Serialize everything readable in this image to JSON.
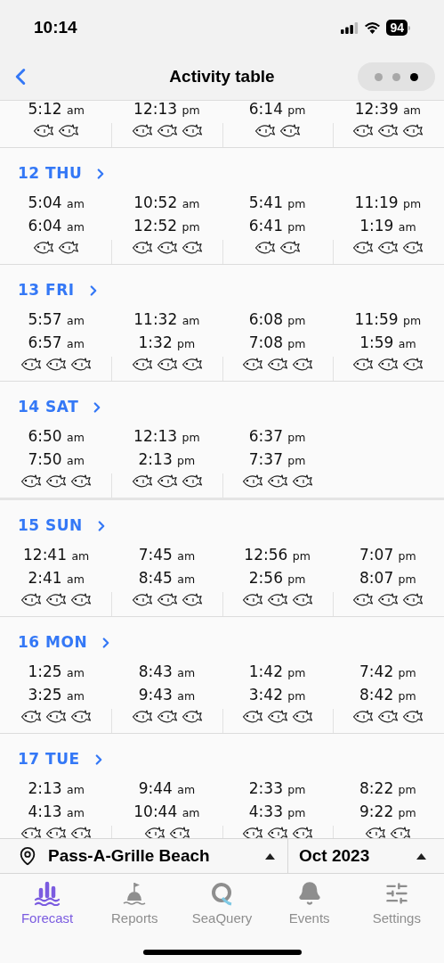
{
  "status_bar": {
    "time": "10:14",
    "battery": "94"
  },
  "nav": {
    "title": "Activity table",
    "pages": [
      {
        "selected": false
      },
      {
        "selected": false
      },
      {
        "selected": true
      }
    ]
  },
  "top_row": {
    "cells": [
      {
        "lines": [
          {
            "time": "5:12",
            "period": "am"
          }
        ],
        "icons": [
          {
            "kind": "fish"
          },
          {
            "kind": "fish"
          }
        ]
      },
      {
        "lines": [
          {
            "time": "12:13",
            "period": "pm"
          }
        ],
        "icons": [
          {
            "kind": "fish"
          },
          {
            "kind": "fish"
          },
          {
            "kind": "fish"
          }
        ]
      },
      {
        "lines": [
          {
            "time": "6:14",
            "period": "pm"
          }
        ],
        "icons": [
          {
            "kind": "fish"
          },
          {
            "kind": "fish"
          }
        ]
      },
      {
        "lines": [
          {
            "time": "12:39",
            "period": "am"
          }
        ],
        "icons": [
          {
            "kind": "fish"
          },
          {
            "kind": "fish"
          },
          {
            "kind": "fish"
          }
        ]
      }
    ]
  },
  "days": [
    {
      "label": "12 THU",
      "cells": [
        {
          "lines": [
            {
              "time": "5:04",
              "period": "am"
            },
            {
              "time": "6:04",
              "period": "am"
            }
          ],
          "icons": [
            {
              "kind": "fish"
            },
            {
              "kind": "fish"
            }
          ]
        },
        {
          "lines": [
            {
              "time": "10:52",
              "period": "am"
            },
            {
              "time": "12:52",
              "period": "pm"
            }
          ],
          "icons": [
            {
              "kind": "fish"
            },
            {
              "kind": "fish"
            },
            {
              "kind": "fish"
            }
          ]
        },
        {
          "lines": [
            {
              "time": "5:41",
              "period": "pm"
            },
            {
              "time": "6:41",
              "period": "pm"
            }
          ],
          "icons": [
            {
              "kind": "fish"
            },
            {
              "kind": "fish"
            }
          ]
        },
        {
          "lines": [
            {
              "time": "11:19",
              "period": "pm"
            },
            {
              "time": "1:19",
              "period": "am"
            }
          ],
          "icons": [
            {
              "kind": "fish"
            },
            {
              "kind": "fish"
            },
            {
              "kind": "fish"
            }
          ]
        }
      ]
    },
    {
      "label": "13 FRI",
      "cells": [
        {
          "lines": [
            {
              "time": "5:57",
              "period": "am"
            },
            {
              "time": "6:57",
              "period": "am"
            }
          ],
          "icons": [
            {
              "kind": "fish"
            },
            {
              "kind": "fish"
            },
            {
              "kind": "fish"
            }
          ]
        },
        {
          "lines": [
            {
              "time": "11:32",
              "period": "am"
            },
            {
              "time": "1:32",
              "period": "pm"
            }
          ],
          "icons": [
            {
              "kind": "fish"
            },
            {
              "kind": "fish"
            },
            {
              "kind": "fish"
            }
          ]
        },
        {
          "lines": [
            {
              "time": "6:08",
              "period": "pm"
            },
            {
              "time": "7:08",
              "period": "pm"
            }
          ],
          "icons": [
            {
              "kind": "fish"
            },
            {
              "kind": "fish"
            },
            {
              "kind": "fish"
            }
          ]
        },
        {
          "lines": [
            {
              "time": "11:59",
              "period": "pm"
            },
            {
              "time": "1:59",
              "period": "am"
            }
          ],
          "icons": [
            {
              "kind": "fish"
            },
            {
              "kind": "fish"
            },
            {
              "kind": "fish"
            }
          ]
        }
      ]
    },
    {
      "label": "14 SAT",
      "cells": [
        {
          "lines": [
            {
              "time": "6:50",
              "period": "am"
            },
            {
              "time": "7:50",
              "period": "am"
            }
          ],
          "icons": [
            {
              "kind": "fish"
            },
            {
              "kind": "fish"
            },
            {
              "kind": "fish"
            }
          ]
        },
        {
          "lines": [
            {
              "time": "12:13",
              "period": "pm"
            },
            {
              "time": "2:13",
              "period": "pm"
            }
          ],
          "icons": [
            {
              "kind": "fish"
            },
            {
              "kind": "fish"
            },
            {
              "kind": "fish"
            }
          ]
        },
        {
          "lines": [
            {
              "time": "6:37",
              "period": "pm"
            },
            {
              "time": "7:37",
              "period": "pm"
            }
          ],
          "icons": [
            {
              "kind": "fish"
            },
            {
              "kind": "fish"
            },
            {
              "kind": "fish"
            }
          ]
        }
      ]
    },
    {
      "label": "15 SUN",
      "cells": [
        {
          "lines": [
            {
              "time": "12:41",
              "period": "am"
            },
            {
              "time": "2:41",
              "period": "am"
            }
          ],
          "icons": [
            {
              "kind": "fish"
            },
            {
              "kind": "fish"
            },
            {
              "kind": "fish"
            }
          ]
        },
        {
          "lines": [
            {
              "time": "7:45",
              "period": "am"
            },
            {
              "time": "8:45",
              "period": "am"
            }
          ],
          "icons": [
            {
              "kind": "fish"
            },
            {
              "kind": "fish"
            },
            {
              "kind": "fish"
            }
          ]
        },
        {
          "lines": [
            {
              "time": "12:56",
              "period": "pm"
            },
            {
              "time": "2:56",
              "period": "pm"
            }
          ],
          "icons": [
            {
              "kind": "fish"
            },
            {
              "kind": "fish"
            },
            {
              "kind": "fish"
            }
          ]
        },
        {
          "lines": [
            {
              "time": "7:07",
              "period": "pm"
            },
            {
              "time": "8:07",
              "period": "pm"
            }
          ],
          "icons": [
            {
              "kind": "fish"
            },
            {
              "kind": "fish"
            },
            {
              "kind": "fish"
            }
          ]
        }
      ]
    },
    {
      "label": "16 MON",
      "cells": [
        {
          "lines": [
            {
              "time": "1:25",
              "period": "am"
            },
            {
              "time": "3:25",
              "period": "am"
            }
          ],
          "icons": [
            {
              "kind": "fish"
            },
            {
              "kind": "fish"
            },
            {
              "kind": "fish"
            }
          ]
        },
        {
          "lines": [
            {
              "time": "8:43",
              "period": "am"
            },
            {
              "time": "9:43",
              "period": "am"
            }
          ],
          "icons": [
            {
              "kind": "fish"
            },
            {
              "kind": "fish"
            },
            {
              "kind": "fish"
            }
          ]
        },
        {
          "lines": [
            {
              "time": "1:42",
              "period": "pm"
            },
            {
              "time": "3:42",
              "period": "pm"
            }
          ],
          "icons": [
            {
              "kind": "fish"
            },
            {
              "kind": "fish"
            },
            {
              "kind": "fish"
            }
          ]
        },
        {
          "lines": [
            {
              "time": "7:42",
              "period": "pm"
            },
            {
              "time": "8:42",
              "period": "pm"
            }
          ],
          "icons": [
            {
              "kind": "fish"
            },
            {
              "kind": "fish"
            },
            {
              "kind": "fish"
            }
          ]
        }
      ]
    },
    {
      "label": "17 TUE",
      "cells": [
        {
          "lines": [
            {
              "time": "2:13",
              "period": "am"
            },
            {
              "time": "4:13",
              "period": "am"
            }
          ],
          "icons": [
            {
              "kind": "fish"
            },
            {
              "kind": "fish"
            },
            {
              "kind": "fish"
            }
          ]
        },
        {
          "lines": [
            {
              "time": "9:44",
              "period": "am"
            },
            {
              "time": "10:44",
              "period": "am"
            }
          ],
          "icons": [
            {
              "kind": "fish"
            },
            {
              "kind": "fish"
            }
          ]
        },
        {
          "lines": [
            {
              "time": "2:33",
              "period": "pm"
            },
            {
              "time": "4:33",
              "period": "pm"
            }
          ],
          "icons": [
            {
              "kind": "fish"
            },
            {
              "kind": "fish"
            },
            {
              "kind": "fish"
            }
          ]
        },
        {
          "lines": [
            {
              "time": "8:22",
              "period": "pm"
            },
            {
              "time": "9:22",
              "period": "pm"
            }
          ],
          "icons": [
            {
              "kind": "fish"
            },
            {
              "kind": "fish"
            }
          ]
        }
      ]
    }
  ],
  "location_bar": {
    "location": "Pass-A-Grille Beach",
    "month": "Oct 2023"
  },
  "tab_bar": [
    {
      "kind": "forecast",
      "label": "Forecast",
      "selected": true
    },
    {
      "kind": "reports",
      "label": "Reports",
      "selected": false
    },
    {
      "kind": "seaquery",
      "label": "SeaQuery",
      "selected": false
    },
    {
      "kind": "events",
      "label": "Events",
      "selected": false
    },
    {
      "kind": "settings",
      "label": "Settings",
      "selected": false
    }
  ]
}
